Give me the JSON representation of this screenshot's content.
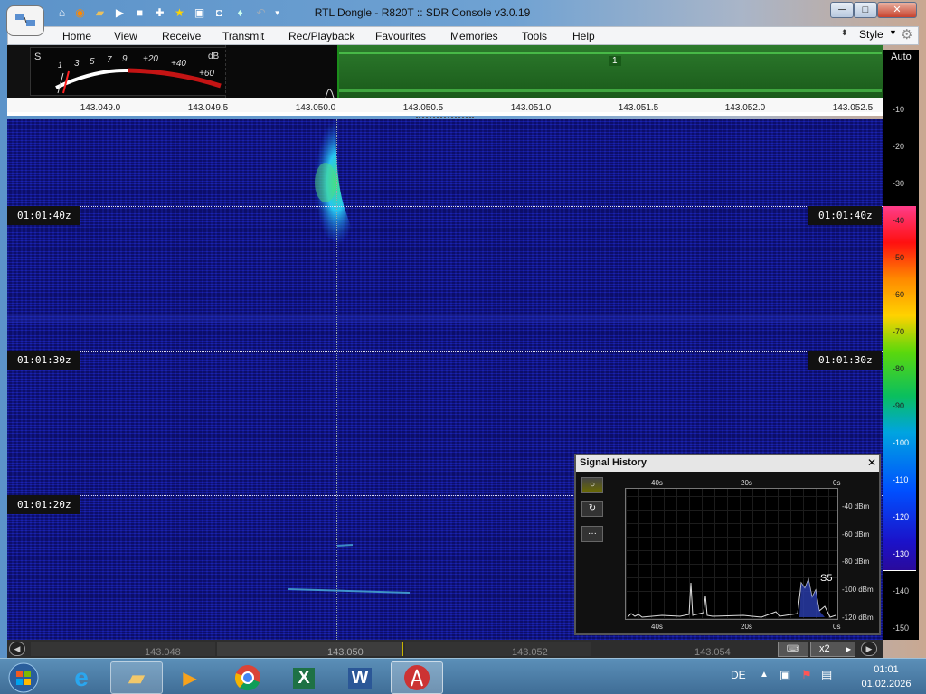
{
  "window": {
    "title": "RTL Dongle - R820T :: SDR Console v3.0.19",
    "minimize_label": "─",
    "maximize_label": "□",
    "close_label": "✕"
  },
  "menu": {
    "items": [
      "Home",
      "View",
      "Receive",
      "Transmit",
      "Rec/Playback",
      "Favourites",
      "Memories",
      "Tools",
      "Help"
    ],
    "style_label": "Style"
  },
  "smeter": {
    "s_label": "S",
    "db_label": "dB",
    "ticks": [
      "1",
      "3",
      "5",
      "7",
      "9",
      "+20",
      "+40",
      "+60"
    ]
  },
  "spectrum": {
    "band_marker": "1"
  },
  "freq_axis": {
    "ticks": [
      "143.049.0",
      "143.049.5",
      "143.050.0",
      "143.050.5",
      "143.051.0",
      "143.051.5",
      "143.052.0",
      "143.052.5"
    ]
  },
  "waterfall": {
    "timestamps": [
      "01:01:40z",
      "01:01:30z",
      "01:01:20z"
    ]
  },
  "colorbar": {
    "auto_label": "Auto",
    "levels": [
      "-10",
      "-20",
      "-30",
      "-40",
      "-50",
      "-60",
      "-70",
      "-80",
      "-90",
      "-100",
      "-110",
      "-120",
      "-130",
      "-140",
      "-150"
    ]
  },
  "signal_history": {
    "title": "Signal History",
    "close_label": "✕",
    "time_top": [
      "40s",
      "20s",
      "0s"
    ],
    "time_bottom": [
      "40s",
      "20s",
      "0s"
    ],
    "dbm_labels": [
      "-40 dBm",
      "-60 dBm",
      "-80 dBm",
      "-100 dBm",
      "-120 dBm"
    ],
    "s_reading": "S5",
    "buttons": [
      "○",
      "↻",
      "···"
    ]
  },
  "bottom_bar": {
    "freqs": [
      "143.048",
      "143.050",
      "143.052",
      "143.054"
    ],
    "zoom_label": "x2"
  },
  "taskbar": {
    "lang": "DE",
    "time": "01:01",
    "date": "01.02.2026"
  }
}
